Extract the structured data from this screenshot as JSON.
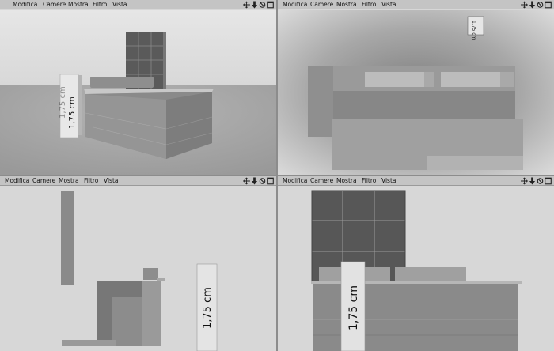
{
  "menu": {
    "items": [
      "Modifica",
      "Camere",
      "Mostra",
      "Filtro",
      "Vista"
    ]
  },
  "icons": [
    "move-icon",
    "down-arrow-icon",
    "rotate-icon",
    "maximize-icon"
  ],
  "viewports": [
    {
      "id": "perspective",
      "dimension_label": "1,75 cm"
    },
    {
      "id": "top",
      "dimension_label": "1,75 cm"
    },
    {
      "id": "right",
      "dimension_label": "1,75 cm"
    },
    {
      "id": "front",
      "dimension_label": "1,75 cm"
    }
  ],
  "colors": {
    "menubar": "#c4c4c4",
    "viewport_bg": "#d7d7d7",
    "separator": "#8c8c8c"
  }
}
